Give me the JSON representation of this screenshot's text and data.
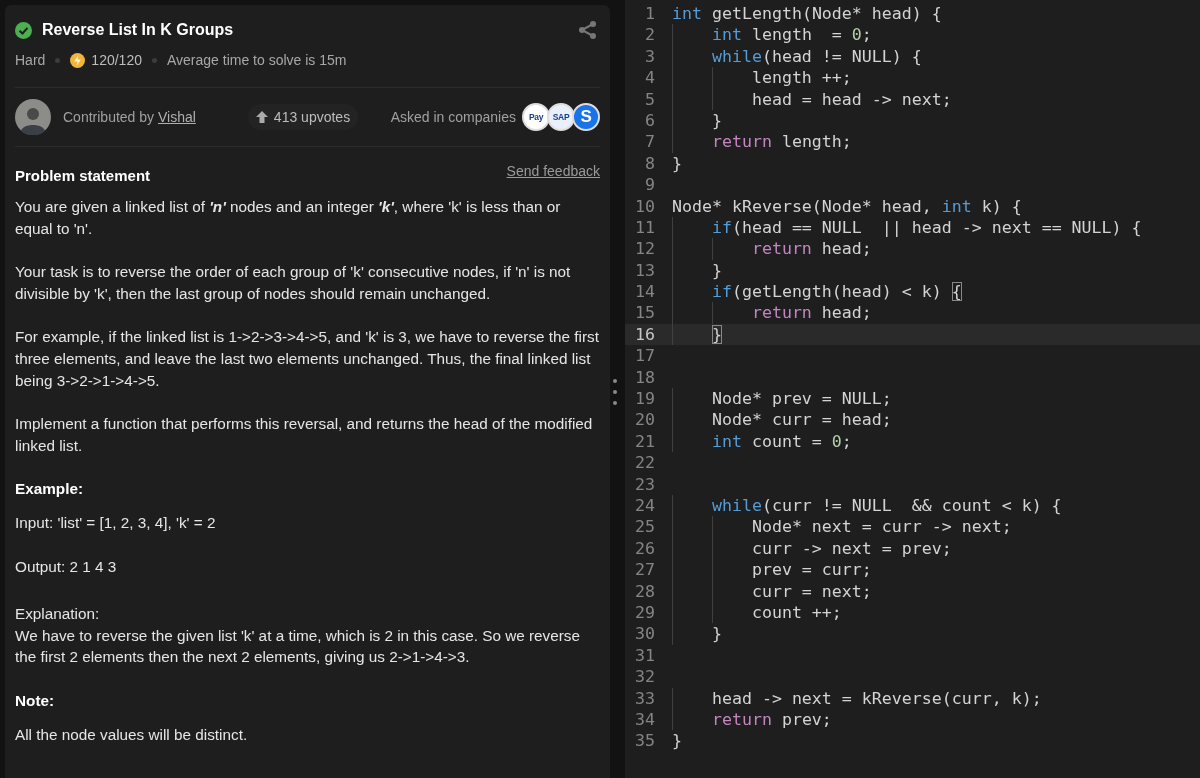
{
  "problem": {
    "title": "Reverse List In K Groups",
    "solved": true,
    "difficulty": "Hard",
    "score": "120/120",
    "average_time": "Average time to solve is 15m",
    "contributor_label": "Contributed by",
    "contributor": "Vishal",
    "upvotes": "413 upvotes",
    "companies_label": "Asked in companies",
    "companies": [
      {
        "text": "Pay",
        "color": "#ffffff"
      },
      {
        "text": "SAP",
        "color": "#e8f0fb"
      },
      {
        "text": "S",
        "color": "#1a73e8"
      }
    ],
    "statement_heading": "Problem statement",
    "feedback_link": "Send feedback",
    "blocks": [
      {
        "kind": "para",
        "text": "You are given a linked list of **'n'** nodes and an integer **'k'**, where 'k' is less than or equal to 'n'."
      },
      {
        "kind": "para",
        "text": "Your task is to reverse the order of each group of 'k' consecutive nodes, if 'n' is not divisible by 'k', then the last group of nodes should remain unchanged."
      },
      {
        "kind": "para",
        "text": "For example, if the linked list is 1->2->3->4->5, and 'k' is 3, we have to reverse the first three elements, and leave the last two elements unchanged. Thus, the final linked list being 3->2->1->4->5."
      },
      {
        "kind": "para",
        "text": "Implement a function that performs this reversal, and returns the head of the modified linked list."
      },
      {
        "kind": "heading",
        "text": "Example:"
      },
      {
        "kind": "para",
        "text": "Input: 'list' = [1, 2, 3, 4], 'k' = 2"
      },
      {
        "kind": "para",
        "text": "Output: 2 1 4 3"
      },
      {
        "kind": "label",
        "text": "Explanation:"
      },
      {
        "kind": "line",
        "text": "We have to reverse the given list 'k' at a time, which is 2 in this case. So we reverse the first 2 elements then the next 2 elements, giving us 2->1->4->3."
      },
      {
        "kind": "heading",
        "text": "Note:"
      },
      {
        "kind": "para",
        "text": "All the node values will be distinct."
      }
    ]
  },
  "editor": {
    "lines": [
      {
        "number": "1",
        "current": false,
        "tokens": [
          {
            "kind": "kw",
            "text": "int"
          },
          {
            "kind": "plain",
            "text": " getLength(Node* head) {"
          }
        ]
      },
      {
        "number": "2",
        "current": false,
        "tokens": [
          {
            "kind": "kw",
            "text": "    int"
          },
          {
            "kind": "plain",
            "text": " length  = "
          },
          {
            "kind": "num",
            "text": "0"
          },
          {
            "kind": "plain",
            "text": ";"
          }
        ]
      },
      {
        "number": "3",
        "current": false,
        "tokens": [
          {
            "kind": "kw",
            "text": "    while"
          },
          {
            "kind": "plain",
            "text": "(head != NULL) {"
          }
        ]
      },
      {
        "number": "4",
        "current": false,
        "tokens": [
          {
            "kind": "plain",
            "text": "        length ++;"
          }
        ]
      },
      {
        "number": "5",
        "current": false,
        "tokens": [
          {
            "kind": "plain",
            "text": "        head = head -> next;"
          }
        ]
      },
      {
        "number": "6",
        "current": false,
        "tokens": [
          {
            "kind": "plain",
            "text": "    }"
          }
        ]
      },
      {
        "number": "7",
        "current": false,
        "tokens": [
          {
            "kind": "ret",
            "text": "    return"
          },
          {
            "kind": "plain",
            "text": " length;"
          }
        ]
      },
      {
        "number": "8",
        "current": false,
        "tokens": [
          {
            "kind": "plain",
            "text": "}"
          }
        ]
      },
      {
        "number": "9",
        "current": false
      },
      {
        "number": "10",
        "current": false,
        "tokens": [
          {
            "kind": "plain",
            "text": "Node* kReverse(Node* head, "
          },
          {
            "kind": "kw",
            "text": "int"
          },
          {
            "kind": "plain",
            "text": " k) {"
          }
        ]
      },
      {
        "number": "11",
        "current": false,
        "tokens": [
          {
            "kind": "kw",
            "text": "    if"
          },
          {
            "kind": "plain",
            "text": "(head == NULL  || head -> next == NULL) {"
          }
        ]
      },
      {
        "number": "12",
        "current": false,
        "tokens": [
          {
            "kind": "ret",
            "text": "        return"
          },
          {
            "kind": "plain",
            "text": " head;"
          }
        ]
      },
      {
        "number": "13",
        "current": false,
        "tokens": [
          {
            "kind": "plain",
            "text": "    }"
          }
        ]
      },
      {
        "number": "14",
        "current": false,
        "tokens": [
          {
            "kind": "kw",
            "text": "    if"
          },
          {
            "kind": "plain",
            "text": "(getLength(head) < k) "
          },
          {
            "kind": "match",
            "text": "{"
          }
        ]
      },
      {
        "number": "15",
        "current": false,
        "tokens": [
          {
            "kind": "ret",
            "text": "        return"
          },
          {
            "kind": "plain",
            "text": " head;"
          }
        ]
      },
      {
        "number": "16",
        "current": true,
        "tokens": [
          {
            "kind": "match",
            "text": "    }"
          }
        ]
      },
      {
        "number": "17",
        "current": false
      },
      {
        "number": "18",
        "current": false
      },
      {
        "number": "19",
        "current": false,
        "tokens": [
          {
            "kind": "plain",
            "text": "    Node* prev = NULL;"
          }
        ]
      },
      {
        "number": "20",
        "current": false,
        "tokens": [
          {
            "kind": "plain",
            "text": "    Node* curr = head;"
          }
        ]
      },
      {
        "number": "21",
        "current": false,
        "tokens": [
          {
            "kind": "kw",
            "text": "    int"
          },
          {
            "kind": "plain",
            "text": " count = "
          },
          {
            "kind": "num",
            "text": "0"
          },
          {
            "kind": "plain",
            "text": ";"
          }
        ]
      },
      {
        "number": "22",
        "current": false
      },
      {
        "number": "23",
        "current": false
      },
      {
        "number": "24",
        "current": false,
        "tokens": [
          {
            "kind": "kw",
            "text": "    while"
          },
          {
            "kind": "plain",
            "text": "(curr != NULL  && count < k) {"
          }
        ]
      },
      {
        "number": "25",
        "current": false,
        "tokens": [
          {
            "kind": "plain",
            "text": "        Node* next = curr -> next;"
          }
        ]
      },
      {
        "number": "26",
        "current": false,
        "tokens": [
          {
            "kind": "plain",
            "text": "        curr -> next = prev;"
          }
        ]
      },
      {
        "number": "27",
        "current": false,
        "tokens": [
          {
            "kind": "plain",
            "text": "        prev = curr;"
          }
        ]
      },
      {
        "number": "28",
        "current": false,
        "tokens": [
          {
            "kind": "plain",
            "text": "        curr = next;"
          }
        ]
      },
      {
        "number": "29",
        "current": false,
        "tokens": [
          {
            "kind": "plain",
            "text": "        count ++;"
          }
        ]
      },
      {
        "number": "30",
        "current": false,
        "tokens": [
          {
            "kind": "plain",
            "text": "    }"
          }
        ]
      },
      {
        "number": "31",
        "current": false
      },
      {
        "number": "32",
        "current": false
      },
      {
        "number": "33",
        "current": false,
        "tokens": [
          {
            "kind": "plain",
            "text": "    head -> next = kReverse(curr, k);"
          }
        ]
      },
      {
        "number": "34",
        "current": false,
        "tokens": [
          {
            "kind": "ret",
            "text": "    return"
          },
          {
            "kind": "plain",
            "text": " prev;"
          }
        ]
      },
      {
        "number": "35",
        "current": false,
        "tokens": [
          {
            "kind": "plain",
            "text": "}"
          }
        ]
      }
    ]
  }
}
